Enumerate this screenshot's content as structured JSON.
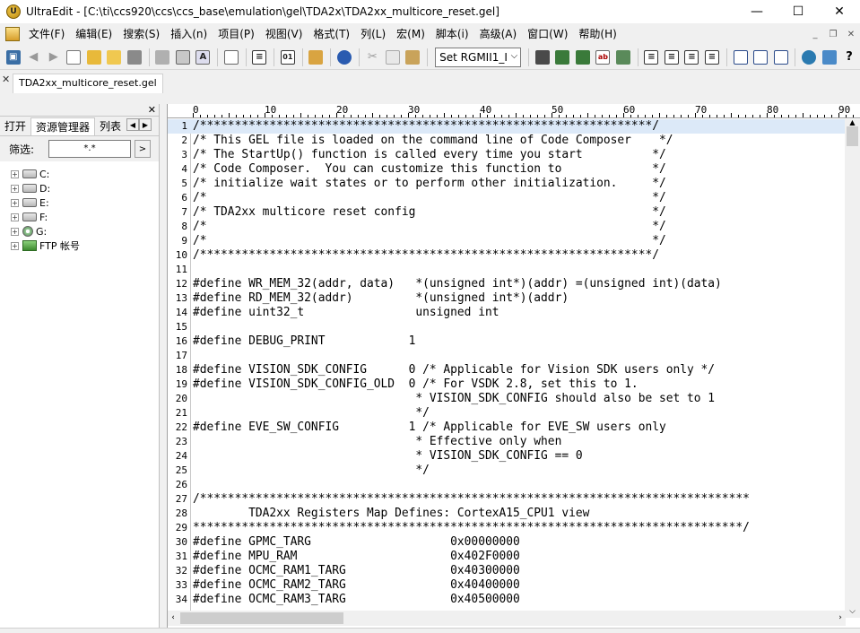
{
  "window": {
    "title": "UltraEdit - [C:\\ti\\ccs920\\ccs\\ccs_base\\emulation\\gel\\TDA2x\\TDA2xx_multicore_reset.gel]",
    "minimize": "—",
    "maximize": "☐",
    "close": "✕"
  },
  "menu": {
    "items": [
      "文件(F)",
      "编辑(E)",
      "搜索(S)",
      "插入(n)",
      "项目(P)",
      "视图(V)",
      "格式(T)",
      "列(L)",
      "宏(M)",
      "脚本(i)",
      "高级(A)",
      "窗口(W)",
      "帮助(H)"
    ],
    "mdi_min": "_",
    "mdi_restore": "❐",
    "mdi_close": "✕"
  },
  "toolbar": {
    "config_select": "Set RGMII1_I"
  },
  "doc_tab": {
    "close": "✕",
    "label": "TDA2xx_multicore_reset.gel"
  },
  "left_panel": {
    "close": "✕",
    "tabs": [
      "打开",
      "资源管理器",
      "列表"
    ],
    "filter_label": "筛选:",
    "filter_value": "*.*",
    "filter_btn": ">",
    "drives": [
      "C:",
      "D:",
      "E:",
      "F:",
      "G:"
    ],
    "ftp": "FTP 帐号"
  },
  "ruler": {
    "marks": [
      "0",
      "10",
      "20",
      "30",
      "40",
      "50",
      "60",
      "70",
      "80",
      "90"
    ]
  },
  "editor": {
    "lines": [
      {
        "n": "1",
        "t": "/*****************************************************************/"
      },
      {
        "n": "2",
        "t": "/* This GEL file is loaded on the command line of Code Composer    */"
      },
      {
        "n": "3",
        "t": "/* The StartUp() function is called every time you start          */"
      },
      {
        "n": "4",
        "t": "/* Code Composer.  You can customize this function to             */"
      },
      {
        "n": "5",
        "t": "/* initialize wait states or to perform other initialization.     */"
      },
      {
        "n": "6",
        "t": "/*                                                                */"
      },
      {
        "n": "7",
        "t": "/* TDA2xx multicore reset config                                  */"
      },
      {
        "n": "8",
        "t": "/*                                                                */"
      },
      {
        "n": "9",
        "t": "/*                                                                */"
      },
      {
        "n": "10",
        "t": "/*****************************************************************/"
      },
      {
        "n": "11",
        "t": ""
      },
      {
        "n": "12",
        "t": "#define WR_MEM_32(addr, data)   *(unsigned int*)(addr) =(unsigned int)(data)"
      },
      {
        "n": "13",
        "t": "#define RD_MEM_32(addr)         *(unsigned int*)(addr)"
      },
      {
        "n": "14",
        "t": "#define uint32_t                unsigned int"
      },
      {
        "n": "15",
        "t": ""
      },
      {
        "n": "16",
        "t": "#define DEBUG_PRINT            1"
      },
      {
        "n": "17",
        "t": ""
      },
      {
        "n": "18",
        "t": "#define VISION_SDK_CONFIG      0 /* Applicable for Vision SDK users only */"
      },
      {
        "n": "19",
        "t": "#define VISION_SDK_CONFIG_OLD  0 /* For VSDK 2.8, set this to 1."
      },
      {
        "n": "20",
        "t": "                                * VISION_SDK_CONFIG should also be set to 1"
      },
      {
        "n": "21",
        "t": "                                */"
      },
      {
        "n": "22",
        "t": "#define EVE_SW_CONFIG          1 /* Applicable for EVE_SW users only"
      },
      {
        "n": "23",
        "t": "                                * Effective only when"
      },
      {
        "n": "24",
        "t": "                                * VISION_SDK_CONFIG == 0"
      },
      {
        "n": "25",
        "t": "                                */"
      },
      {
        "n": "26",
        "t": ""
      },
      {
        "n": "27",
        "t": "/*******************************************************************************"
      },
      {
        "n": "28",
        "t": "        TDA2xx Registers Map Defines: CortexA15_CPU1 view"
      },
      {
        "n": "29",
        "t": "*******************************************************************************/"
      },
      {
        "n": "30",
        "t": "#define GPMC_TARG                    0x00000000"
      },
      {
        "n": "31",
        "t": "#define MPU_RAM                      0x402F0000"
      },
      {
        "n": "32",
        "t": "#define OCMC_RAM1_TARG               0x40300000"
      },
      {
        "n": "33",
        "t": "#define OCMC_RAM2_TARG               0x40400000"
      },
      {
        "n": "34",
        "t": "#define OCMC_RAM3_TARG               0x40500000"
      }
    ]
  },
  "colors": {
    "active_line": "#dce9f8",
    "background": "#f0f0f0"
  }
}
